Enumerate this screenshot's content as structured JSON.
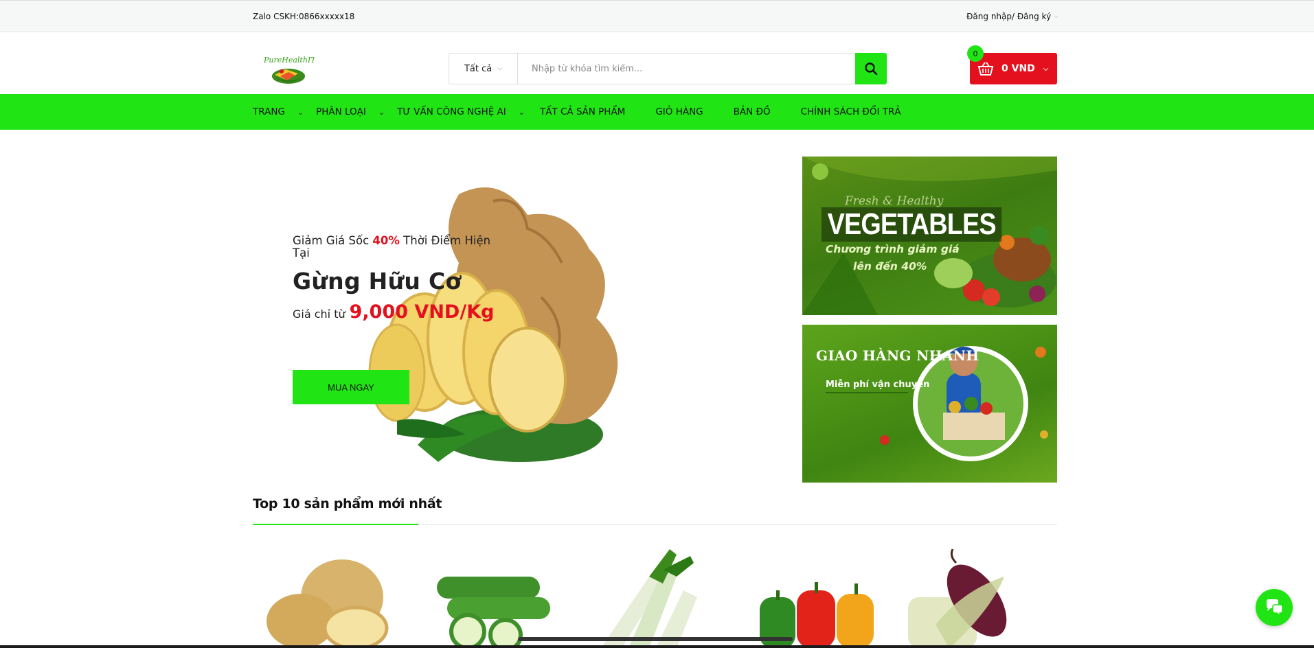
{
  "topbar": {
    "hotline": "Zalo CSKH:0866xxxxx18",
    "login": "Đăng nhập/ Đăng ký"
  },
  "logo": {
    "text": "PureHealthIT"
  },
  "search": {
    "category": "Tất cả",
    "placeholder": "Nhập từ khóa tìm kiếm...",
    "icon": "search-icon"
  },
  "cart": {
    "total": "0 VND",
    "count": "0",
    "icon": "basket-icon"
  },
  "nav": {
    "items": [
      {
        "label": "TRANG",
        "has_dropdown": true
      },
      {
        "label": "PHÂN LOẠI",
        "has_dropdown": true
      },
      {
        "label": "TƯ VẤN CÔNG NGHỆ AI",
        "has_dropdown": true
      },
      {
        "label": "TẤT CẢ SẢN PHẨM",
        "has_dropdown": false
      },
      {
        "label": "GIỎ HÀNG",
        "has_dropdown": false
      },
      {
        "label": "BẢN ĐỒ",
        "has_dropdown": false
      },
      {
        "label": "CHÍNH SÁCH ĐỔI TRẢ",
        "has_dropdown": false
      }
    ]
  },
  "hero": {
    "promo_prefix": "Giảm Giá Sốc ",
    "promo_percent": "40%",
    "promo_suffix": " Thời Điểm Hiện Tại",
    "product_name": "Gừng Hữu Cơ",
    "price_label": "Giá chỉ từ",
    "price": "9,000 VND/Kg",
    "cta": "MUA NGAY"
  },
  "banners": {
    "vegetables": {
      "tagline": "Fresh & Healthy",
      "title": "VEGETABLES",
      "line1": "Chương trình giảm giá",
      "line2": "lên đến 40%"
    },
    "delivery": {
      "title": "GIAO HÀNG NHANH",
      "subtitle": "Miễn phí vận chuyển"
    }
  },
  "section": {
    "title": "Top 10 sản phẩm mới nhất"
  },
  "products": [
    {
      "name": "potato"
    },
    {
      "name": "cucumber"
    },
    {
      "name": "leek"
    },
    {
      "name": "bell-pepper"
    },
    {
      "name": "purple-corn"
    }
  ],
  "colors": {
    "accent_green": "#21e414",
    "accent_red": "#e5101d"
  }
}
